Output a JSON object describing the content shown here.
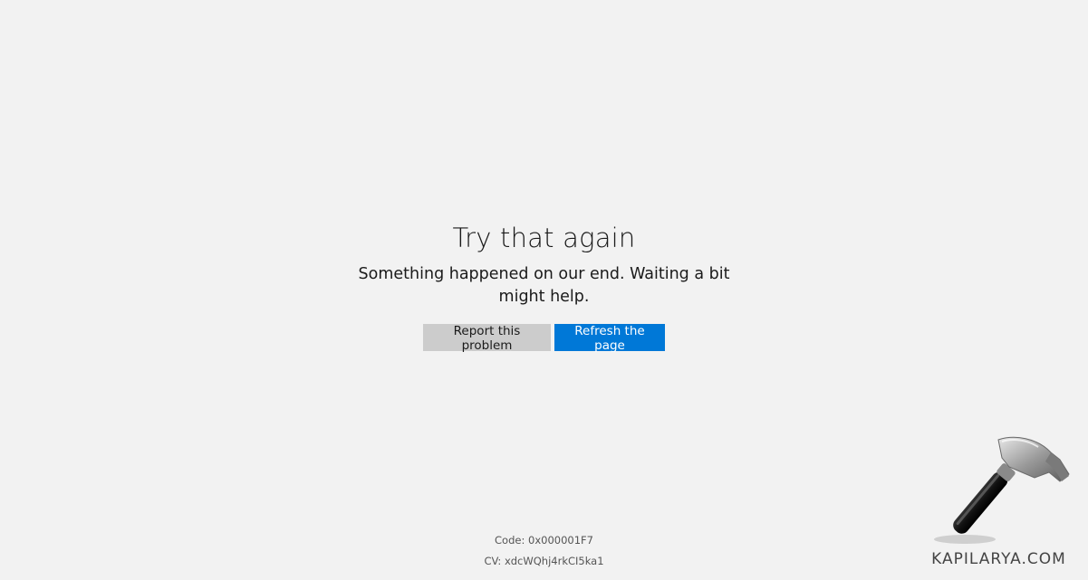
{
  "error": {
    "title": "Try that again",
    "message": "Something happened on our end. Waiting a bit might help."
  },
  "actions": {
    "report_label": "Report this problem",
    "refresh_label": "Refresh the page"
  },
  "footer": {
    "code": "Code: 0x000001F7",
    "cv": "CV: xdcWQhj4rkCI5ka1"
  },
  "watermark": {
    "text": "KAPILARYA.COM",
    "icon": "hammer-icon"
  },
  "colors": {
    "background": "#f2f2f2",
    "report_button": "#cccccc",
    "refresh_button": "#0078d7"
  }
}
